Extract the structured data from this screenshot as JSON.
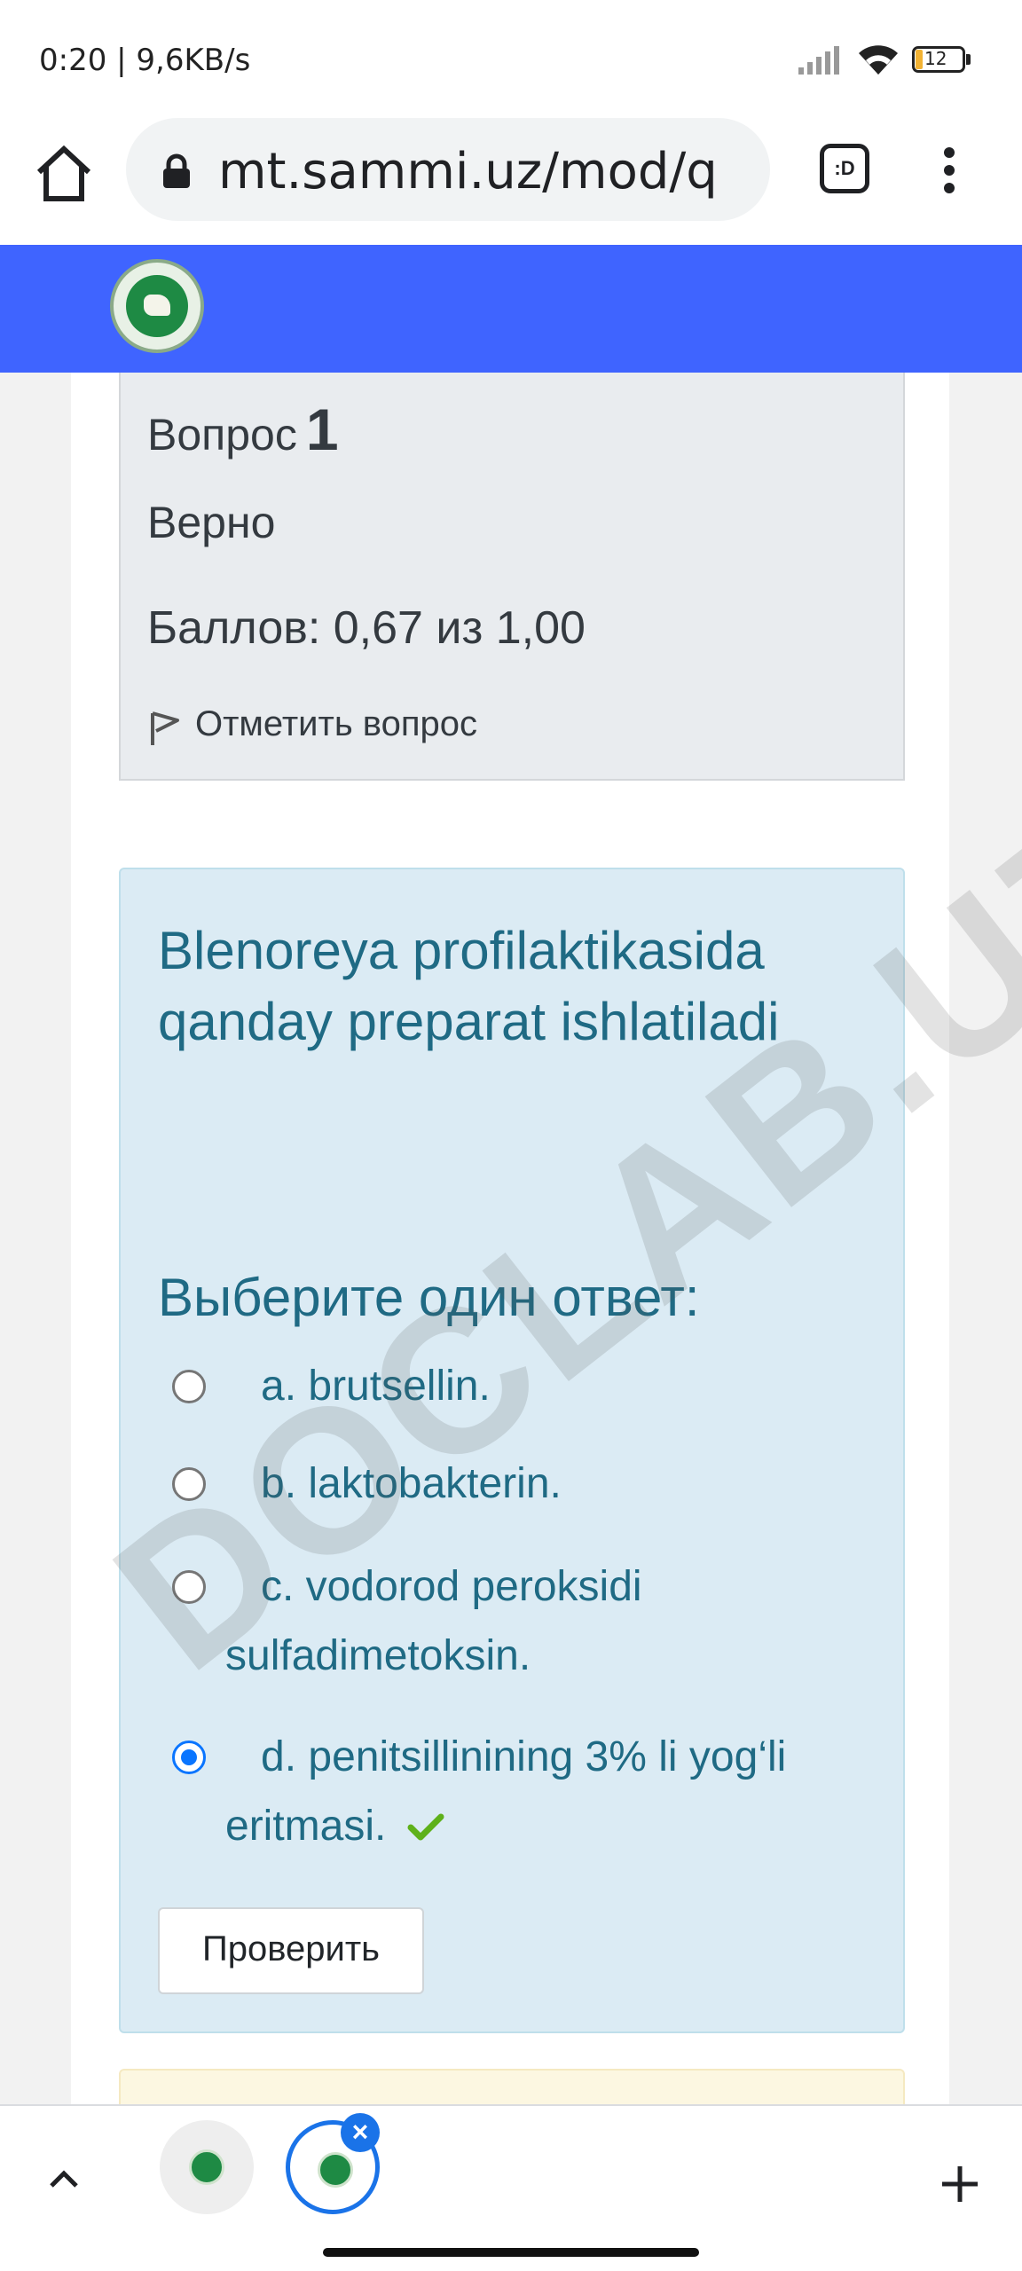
{
  "status_bar": {
    "time_speed": "0:20 | 9,6KB/s",
    "battery": "12"
  },
  "browser": {
    "url": "mt.sammi.uz/mod/q",
    "tabs_icon_label": ":D"
  },
  "question_info": {
    "title_label": "Вопрос",
    "number": "1",
    "state": "Верно",
    "grade": "Баллов: 0,67 из 1,00",
    "flag_label": "Отметить вопрос"
  },
  "question": {
    "text": "Blenoreya profilaktikasida qanday preparat ishlatiladi",
    "prompt": "Выберите один ответ:",
    "options": [
      {
        "line1": "a. brutsellin.",
        "line2": ""
      },
      {
        "line1": "b. laktobakterin.",
        "line2": ""
      },
      {
        "line1": "c. vodorod peroksidi",
        "line2": "sulfadimetoksin."
      },
      {
        "line1": "d. penitsillinining 3% li yog‘li",
        "line2": "eritmasi."
      }
    ],
    "selected_index": 3,
    "check_button": "Проверить"
  },
  "watermark": "DOCLAB.UZ",
  "colors": {
    "header_blue": "#3f64ff",
    "question_bg": "#dbebf4",
    "question_text": "#1f6a84",
    "correct_green": "#5eb11a"
  }
}
